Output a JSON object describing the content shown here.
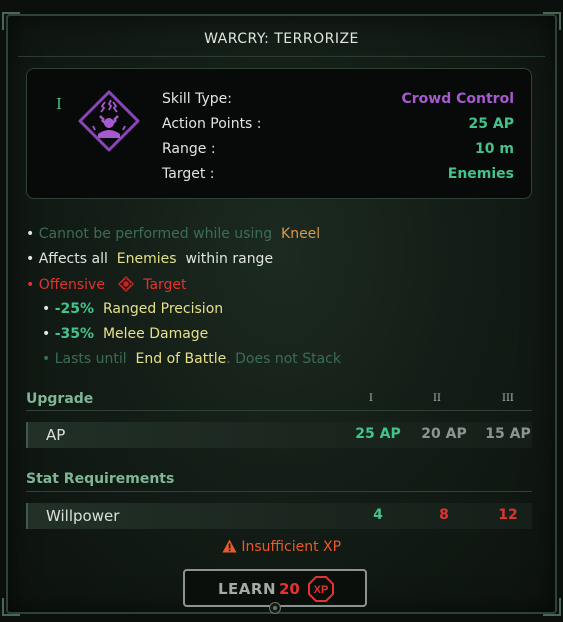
{
  "title": "WARCRY: TERRORIZE",
  "rank_marker": "I",
  "icon": "terrorize-skill-icon",
  "info": [
    {
      "label": "Skill Type:",
      "value": "Crowd Control",
      "color": "#a75ad0"
    },
    {
      "label": "Action Points :",
      "value": "25 AP",
      "color": "#45c28b"
    },
    {
      "label": "Range :",
      "value": "10 m",
      "color": "#45c28b"
    },
    {
      "label": "Target :",
      "value": "Enemies",
      "color": "#45c28b"
    }
  ],
  "effects": {
    "line1": {
      "bullet": "•",
      "text": "Cannot be performed while using",
      "highlight": "Kneel"
    },
    "line2": {
      "bullet": "•",
      "text": "Affects all",
      "highlight": "Enemies",
      "tail": "within range"
    },
    "line3": {
      "bullet": "•",
      "label": "Offensive",
      "target_icon": "target-reticle-icon",
      "target": "Target"
    },
    "line4": {
      "bullet": "•",
      "value": "-25%",
      "text": "Ranged Precision"
    },
    "line5": {
      "bullet": "•",
      "value": "-35%",
      "text": "Melee Damage"
    },
    "line6": {
      "bullet": "•",
      "text": "Lasts until",
      "highlight": "End of Battle",
      "tail": ". Does not Stack"
    }
  },
  "upgrade": {
    "header": "Upgrade",
    "tiers": [
      "I",
      "II",
      "III"
    ],
    "row": {
      "label": "AP",
      "values": [
        "25 AP",
        "20 AP",
        "15 AP"
      ]
    }
  },
  "requirements": {
    "header": "Stat Requirements",
    "row": {
      "label": "Willpower",
      "values": [
        "4",
        "8",
        "12"
      ]
    }
  },
  "warning": {
    "icon": "warning-triangle-icon",
    "text": "Insufficient XP"
  },
  "learn": {
    "label": "LEARN",
    "cost": "20",
    "currency": "XP"
  },
  "colors": {
    "accent_green": "#45c28b",
    "warning_red": "#e0342f",
    "purple": "#a75ad0",
    "yellow": "#e6e08a"
  }
}
